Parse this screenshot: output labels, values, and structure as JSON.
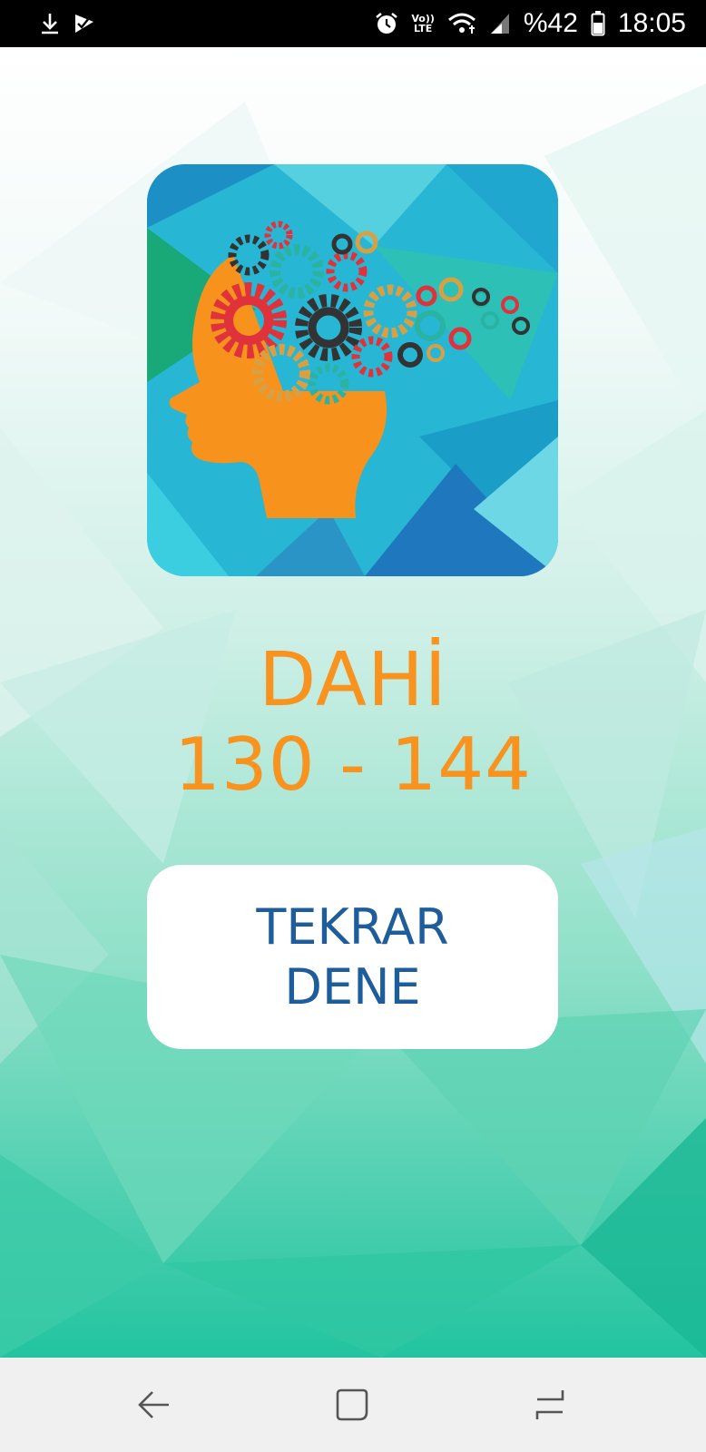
{
  "status_bar": {
    "battery_text": "%42",
    "time": "18:05",
    "volte_top": "Vo))",
    "volte_bottom": "LTE",
    "icons": [
      "download-icon",
      "check-flag-icon",
      "alarm-icon",
      "volte-icon",
      "wifi-icon",
      "signal-icon",
      "battery-icon"
    ]
  },
  "result": {
    "title": "DAHİ",
    "range": "130 - 144"
  },
  "retry_button": {
    "line1": "TEKRAR",
    "line2": "DENE"
  },
  "nav_bar": {
    "icons": [
      "back-icon",
      "home-icon",
      "recents-icon"
    ]
  },
  "colors": {
    "accent_orange": "#f7931e",
    "button_text_blue": "#1e5d9c",
    "background_teal": "#2cc8a0"
  }
}
